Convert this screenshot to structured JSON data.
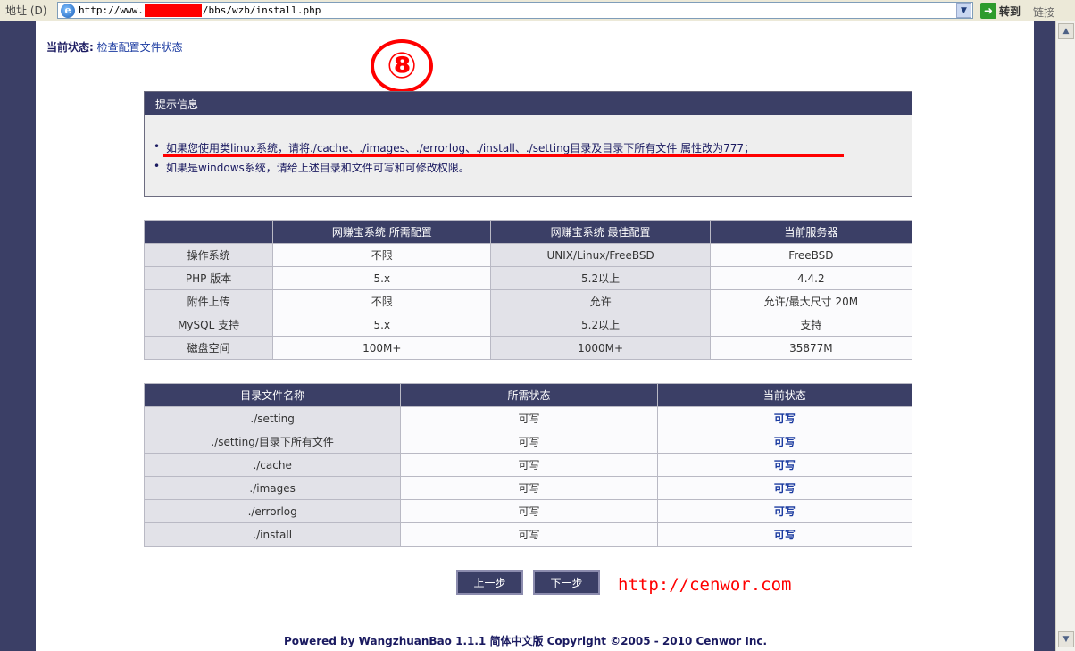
{
  "browser": {
    "address_label": "地址 (D)",
    "url_prefix": "http://www.",
    "url_suffix": "/bbs/wzb/install.php",
    "go_label": "转到",
    "links_label": "链接"
  },
  "status": {
    "label": "当前状态:",
    "value": "检查配置文件状态"
  },
  "step_badge": "⑧",
  "tips": {
    "title": "提示信息",
    "items": [
      "如果您使用类linux系统，请将./cache、./images、./errorlog、./install、./setting目录及目录下所有文件 属性改为777；",
      "如果是windows系统，请给上述目录和文件可写和可修改权限。"
    ]
  },
  "config_table": {
    "headers": [
      "",
      "网赚宝系统 所需配置",
      "网赚宝系统 最佳配置",
      "当前服务器"
    ],
    "rows": [
      [
        "操作系统",
        "不限",
        "UNIX/Linux/FreeBSD",
        "FreeBSD"
      ],
      [
        "PHP 版本",
        "5.x",
        "5.2以上",
        "4.4.2"
      ],
      [
        "附件上传",
        "不限",
        "允许",
        "允许/最大尺寸 20M"
      ],
      [
        "MySQL 支持",
        "5.x",
        "5.2以上",
        "支持"
      ],
      [
        "磁盘空间",
        "100M+",
        "1000M+",
        "35877M"
      ]
    ]
  },
  "dir_table": {
    "headers": [
      "目录文件名称",
      "所需状态",
      "当前状态"
    ],
    "rows": [
      [
        "./setting",
        "可写",
        "可写"
      ],
      [
        "./setting/目录下所有文件",
        "可写",
        "可写"
      ],
      [
        "./cache",
        "可写",
        "可写"
      ],
      [
        "./images",
        "可写",
        "可写"
      ],
      [
        "./errorlog",
        "可写",
        "可写"
      ],
      [
        "./install",
        "可写",
        "可写"
      ]
    ]
  },
  "buttons": {
    "prev": "上一步",
    "next": "下一步"
  },
  "site_url": "http://cenwor.com",
  "footer": "Powered by WangzhuanBao 1.1.1 简体中文版  Copyright ©2005 - 2010 Cenwor Inc.",
  "colors": {
    "frame": "#3b3f66",
    "annotation_red": "#ff0000"
  }
}
